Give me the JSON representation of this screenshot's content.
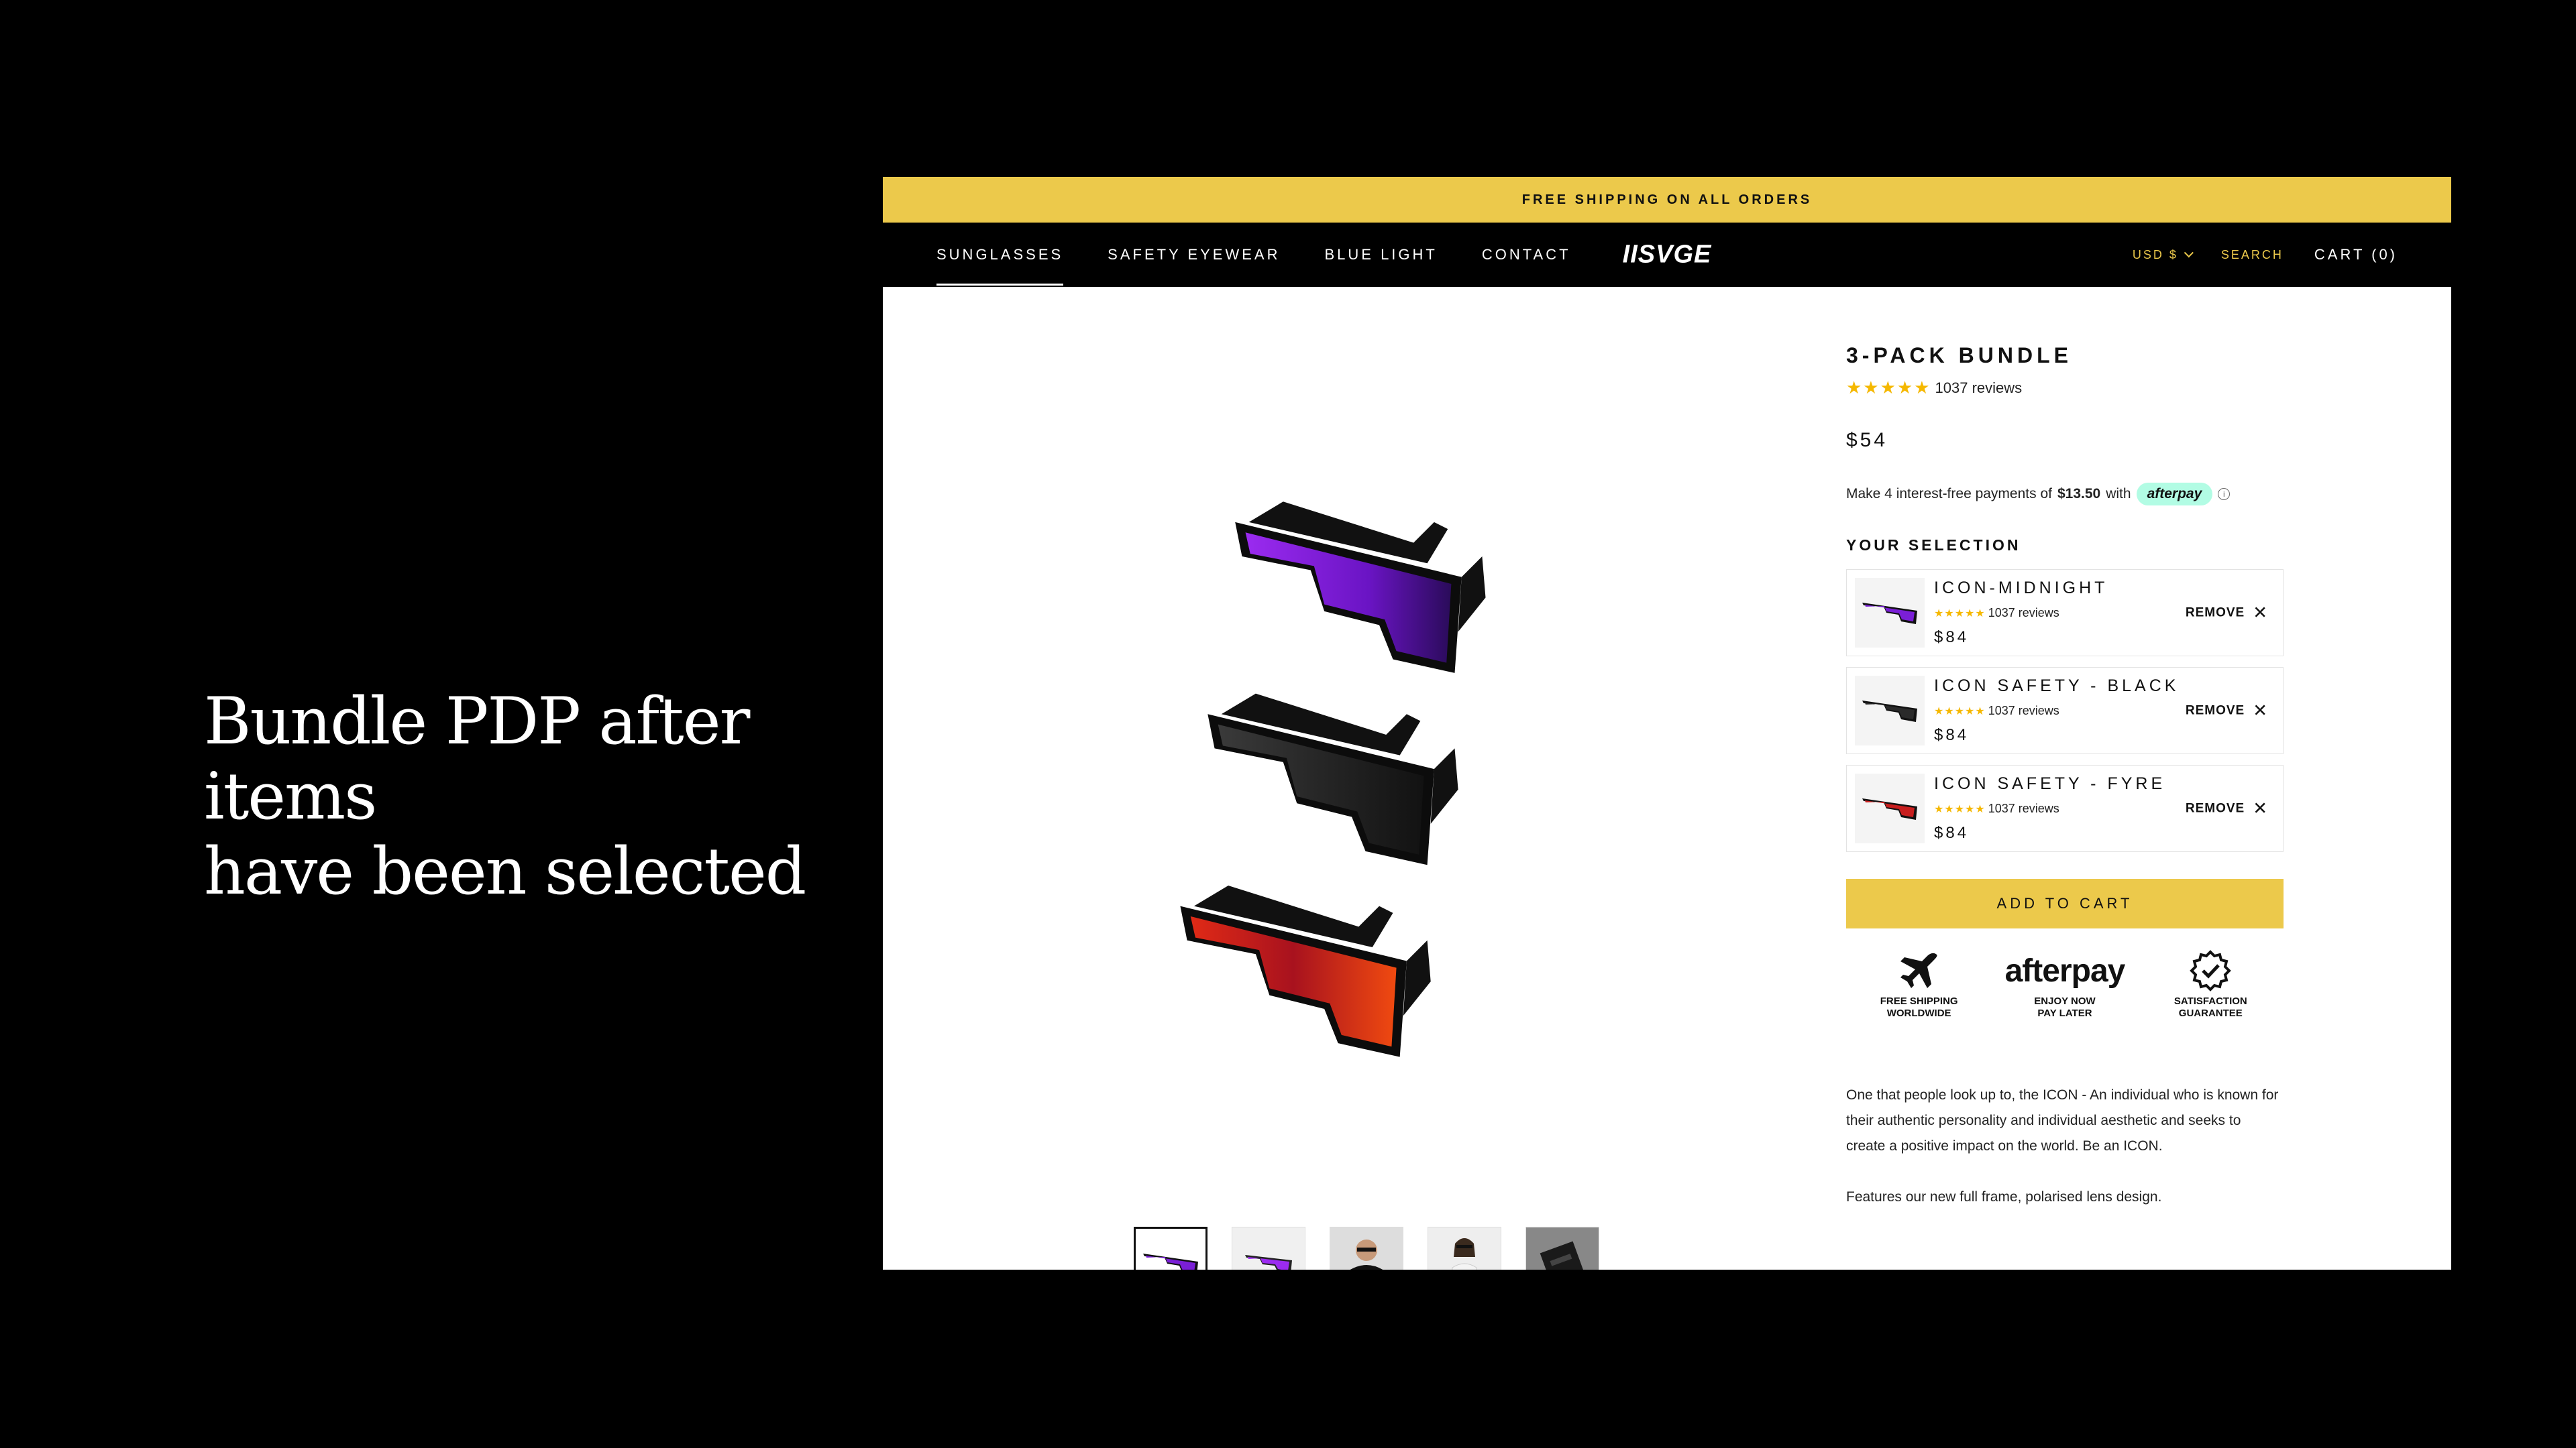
{
  "caption": {
    "line1": "Bundle PDP after items",
    "line2": "have been selected"
  },
  "announcement": "FREE SHIPPING ON ALL ORDERS",
  "nav": {
    "links": [
      "SUNGLASSES",
      "SAFETY EYEWEAR",
      "BLUE LIGHT",
      "CONTACT"
    ],
    "active": "SUNGLASSES",
    "logo": "IISVGE",
    "currency": "USD $",
    "search": "SEARCH",
    "cart": "CART (0)"
  },
  "product": {
    "title": "3-PACK BUNDLE",
    "stars": "★★★★★",
    "reviews": "1037 reviews",
    "price": "$54",
    "afterpay": {
      "prefix": "Make 4 interest-free payments of",
      "amount": "$13.50",
      "suffix": "with",
      "badge": "afterpay"
    },
    "selection_heading": "YOUR SELECTION",
    "selection": [
      {
        "name": "ICON-MIDNIGHT",
        "stars": "★★★★★",
        "reviews": "1037 reviews",
        "price": "$84",
        "remove": "REMOVE",
        "lens_color": "#7a1fd6"
      },
      {
        "name": "ICON SAFETY - BLACK",
        "stars": "★★★★★",
        "reviews": "1037 reviews",
        "price": "$84",
        "remove": "REMOVE",
        "lens_color": "#1c1c1c"
      },
      {
        "name": "ICON SAFETY - FYRE",
        "stars": "★★★★★",
        "reviews": "1037 reviews",
        "price": "$84",
        "remove": "REMOVE",
        "lens_color": "#c81e1e"
      }
    ],
    "add_to_cart": "ADD TO CART",
    "badges": {
      "shipping": {
        "line1": "FREE SHIPPING",
        "line2": "WORLDWIDE"
      },
      "afterpay": {
        "word": "afterpay",
        "line1": "ENJOY NOW",
        "line2": "PAY LATER"
      },
      "guarantee": {
        "line1": "SATISFACTION",
        "line2": "GUARANTEE"
      }
    },
    "description": [
      "One that people look up to, the ICON - An individual who is known for their authentic personality and individual aesthetic and seeks to create a positive impact on the world. Be an ICON.",
      "Features our new full frame, polarised lens design."
    ]
  },
  "colors": {
    "accent": "#ecc94b",
    "purple_lens": "#7a1fd6",
    "red_lens": "#c81e1e",
    "afterpay_mint": "#b2fce4"
  }
}
